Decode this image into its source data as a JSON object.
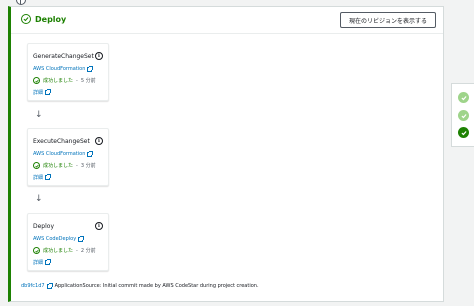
{
  "stage": {
    "title": "Deploy",
    "review_button": "現在のリビジョンを表示する"
  },
  "actions": [
    {
      "name": "GenerateChangeSet",
      "provider": "AWS CloudFormation",
      "status": "成功しました",
      "separator": "-",
      "time": "5 分前",
      "details": "詳細"
    },
    {
      "name": "ExecuteChangeSet",
      "provider": "AWS CloudFormation",
      "status": "成功しました",
      "separator": "-",
      "time": "3 分前",
      "details": "詳細"
    },
    {
      "name": "Deploy",
      "provider": "AWS CodeDeploy",
      "status": "成功しました",
      "separator": "-",
      "time": "2 分前",
      "details": "詳細"
    }
  ],
  "footer": {
    "commit_id": "db9fc1d7",
    "message": "ApplicationSource: Initial commit made by AWS CodeStar during project creation."
  },
  "side_panel": {
    "states": [
      "succeeded",
      "succeeded",
      "succeeded"
    ]
  },
  "colors": {
    "success": "#1d8102",
    "success_light": "#9ed48a",
    "link": "#0073bb",
    "border": "#d5dbdb"
  },
  "icons": {
    "stage_status": "check-circle-icon",
    "info": "info-icon",
    "external_link": "external-link-icon",
    "arrow": "arrow-down-icon"
  }
}
